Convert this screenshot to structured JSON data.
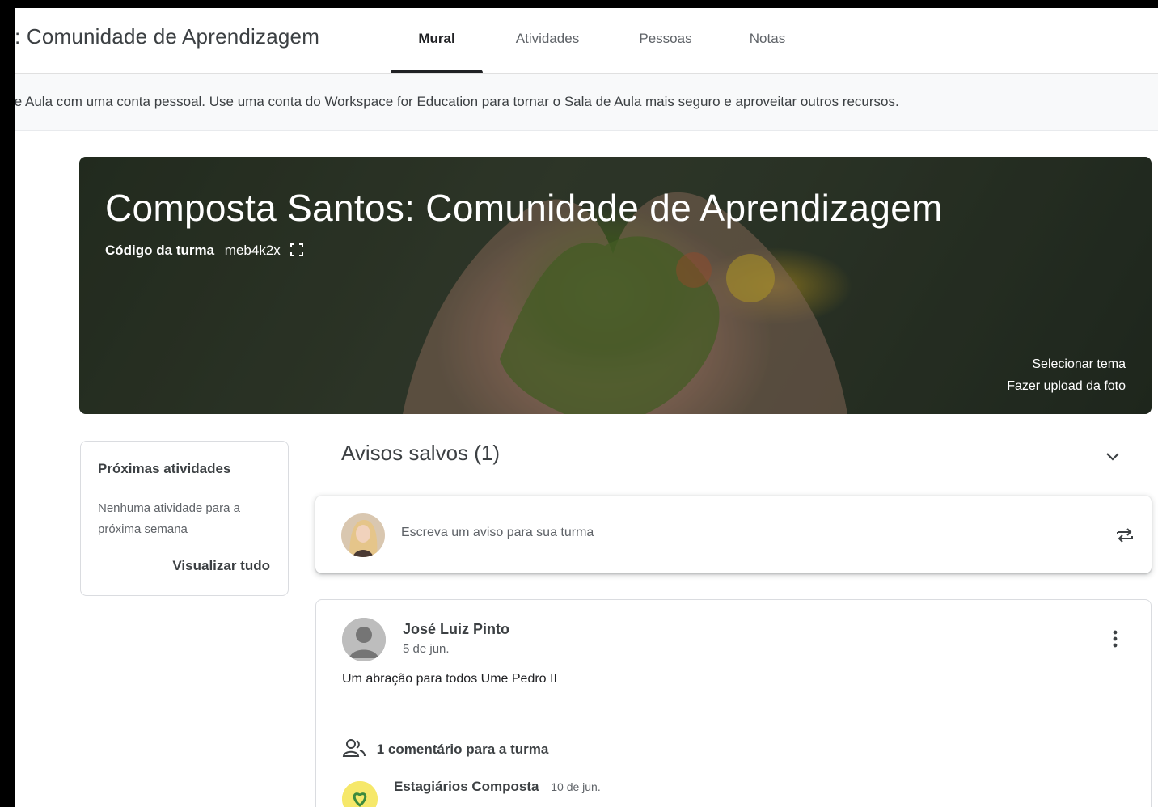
{
  "header": {
    "class_title": ": Comunidade de Aprendizagem",
    "tabs": [
      {
        "label": "Mural",
        "active": true
      },
      {
        "label": "Atividades",
        "active": false
      },
      {
        "label": "Pessoas",
        "active": false
      },
      {
        "label": "Notas",
        "active": false
      }
    ]
  },
  "notice": {
    "text": "le Aula com uma conta pessoal. Use uma conta do Workspace for Education para tornar o Sala de Aula mais seguro e aproveitar outros recursos."
  },
  "banner": {
    "title": "Composta Santos: Comunidade de Aprendizagem",
    "code_label": "Código da turma",
    "code_value": "meb4k2x",
    "select_theme": "Selecionar tema",
    "upload_photo": "Fazer upload da foto"
  },
  "upcoming": {
    "title": "Próximas atividades",
    "empty_text": "Nenhuma atividade para a próxima semana",
    "view_all": "Visualizar tudo"
  },
  "stream": {
    "saved_title": "Avisos salvos (1)",
    "compose_placeholder": "Escreva um aviso para sua turma",
    "post": {
      "author": "José Luiz Pinto",
      "date": "5 de jun.",
      "body": "Um abração para todos  Ume Pedro II",
      "comments_count": "1 comentário para a turma",
      "comment": {
        "author": "Estagiários Composta",
        "date": "10 de jun."
      }
    }
  },
  "colors": {
    "accent": "#202124",
    "tab_inactive": "#5f6368",
    "notice_bg": "#f8f9fa",
    "card_border": "#dadce0"
  }
}
